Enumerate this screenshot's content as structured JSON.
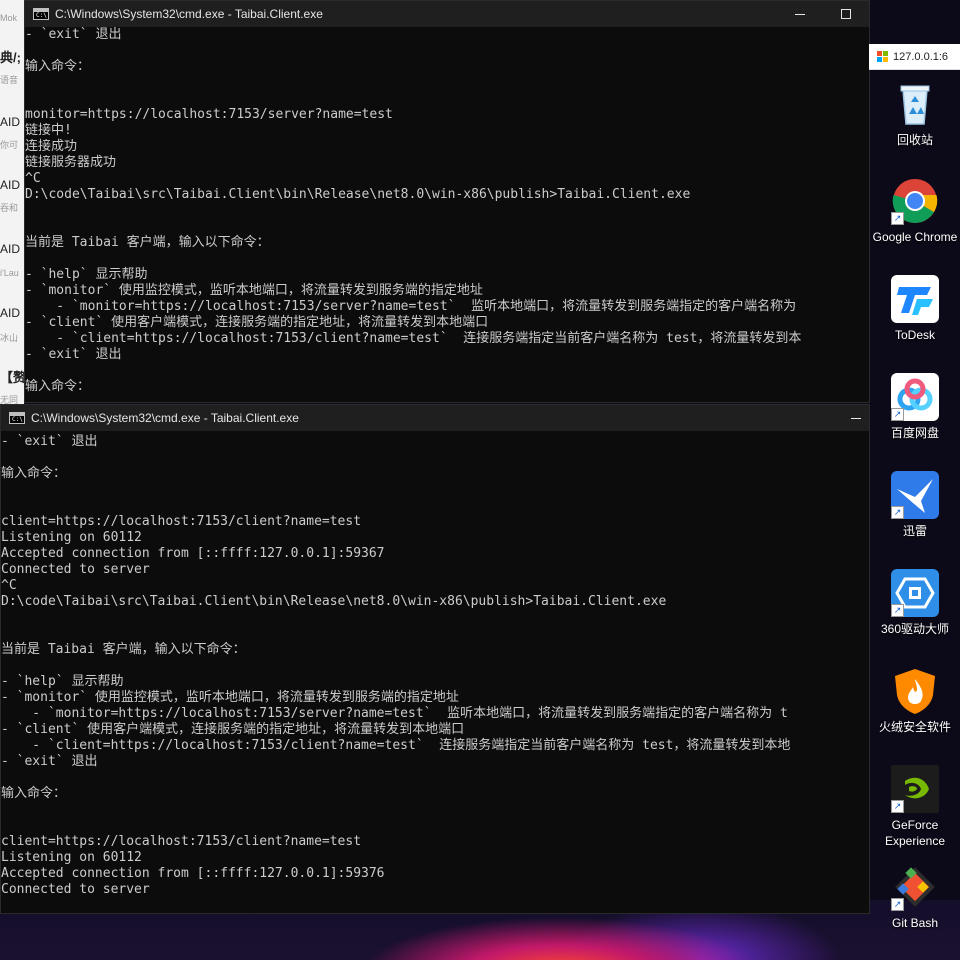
{
  "background_app": {
    "lines": [
      "Mok",
      "典/;",
      "语音",
      "AID",
      "你可",
      "AID",
      "吞和",
      "AID",
      "i'Lau",
      "AID",
      "冰山",
      "【赘",
      "无同"
    ]
  },
  "window_top": {
    "title": "C:\\Windows\\System32\\cmd.exe - Taibai.Client.exe",
    "icon_text": "C:\\",
    "lines": [
      "- `exit` 退出",
      "",
      "输入命令：",
      "",
      "",
      "monitor=https://localhost:7153/server?name=test",
      "链接中!",
      "连接成功",
      "链接服务器成功",
      "^C",
      "D:\\code\\Taibai\\src\\Taibai.Client\\bin\\Release\\net8.0\\win-x86\\publish>Taibai.Client.exe",
      "",
      "",
      "当前是 Taibai 客户端，输入以下命令：",
      "",
      "- `help` 显示帮助",
      "- `monitor` 使用监控模式，监听本地端口，将流量转发到服务端的指定地址",
      "    - `monitor=https://localhost:7153/server?name=test`  监听本地端口，将流量转发到服务端指定的客户端名称为",
      "- `client` 使用客户端模式，连接服务端的指定地址，将流量转发到本地端口",
      "    - `client=https://localhost:7153/client?name=test`  连接服务端指定当前客户端名称为 test，将流量转发到本",
      "- `exit` 退出",
      "",
      "输入命令："
    ]
  },
  "window_bottom": {
    "title": "C:\\Windows\\System32\\cmd.exe - Taibai.Client.exe",
    "icon_text": "C:\\",
    "lines": [
      "- `exit` 退出",
      "",
      "输入命令：",
      "",
      "",
      "client=https://localhost:7153/client?name=test",
      "Listening on 60112",
      "Accepted connection from [::ffff:127.0.0.1]:59367",
      "Connected to server",
      "^C",
      "D:\\code\\Taibai\\src\\Taibai.Client\\bin\\Release\\net8.0\\win-x86\\publish>Taibai.Client.exe",
      "",
      "",
      "当前是 Taibai 客户端，输入以下命令：",
      "",
      "- `help` 显示帮助",
      "- `monitor` 使用监控模式，监听本地端口，将流量转发到服务端的指定地址",
      "    - `monitor=https://localhost:7153/server?name=test`  监听本地端口，将流量转发到服务端指定的客户端名称为 t",
      "- `client` 使用客户端模式，连接服务端的指定地址，将流量转发到本地端口",
      "    - `client=https://localhost:7153/client?name=test`  连接服务端指定当前客户端名称为 test，将流量转发到本地",
      "- `exit` 退出",
      "",
      "输入命令：",
      "",
      "",
      "client=https://localhost:7153/client?name=test",
      "Listening on 60112",
      "Accepted connection from [::ffff:127.0.0.1]:59376",
      "Connected to server"
    ]
  },
  "browser": {
    "tab_text": "127.0.0.1:6"
  },
  "desktop_icons": [
    {
      "name": "recycle-bin",
      "label": "回收站",
      "shortcut": false,
      "color": "#d7eaf7"
    },
    {
      "name": "google-chrome",
      "label": "Google Chrome",
      "shortcut": true,
      "color": "#ffffff"
    },
    {
      "name": "todesk",
      "label": "ToDesk",
      "shortcut": false,
      "color": "#ffffff"
    },
    {
      "name": "baidu-netdisk",
      "label": "百度网盘",
      "shortcut": true,
      "color": "#ffffff"
    },
    {
      "name": "xunlei",
      "label": "迅雷",
      "shortcut": true,
      "color": "#2f7bea"
    },
    {
      "name": "360-driver",
      "label": "360驱动大师",
      "shortcut": true,
      "color": "#2e8ee8"
    },
    {
      "name": "huorong",
      "label": "火绒安全软件",
      "shortcut": false,
      "color": "#ff8a00"
    },
    {
      "name": "geforce-experience",
      "label": "GeForce Experience",
      "shortcut": true,
      "color": "#1c1c1c"
    },
    {
      "name": "git-bash",
      "label": "Git Bash",
      "shortcut": true,
      "color": "#f0f0f0"
    }
  ],
  "colors": {
    "console_bg": "#0c0c0c",
    "console_text": "#cccccc",
    "titlebar_bg": "#1f1f1f"
  }
}
